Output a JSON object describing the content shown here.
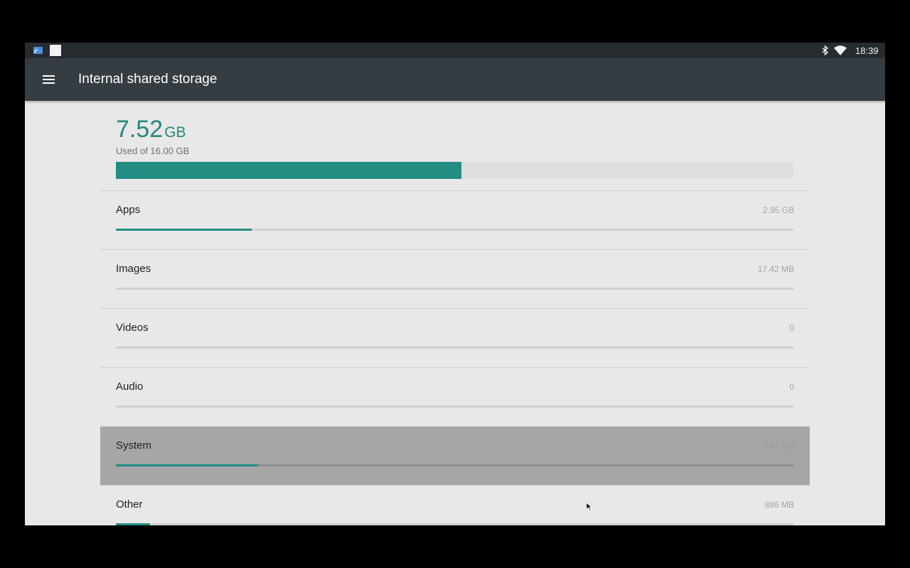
{
  "status_bar": {
    "time": "18:39",
    "left_icons": [
      "screen-cast-icon",
      "notification-square-icon"
    ],
    "right_icons": [
      "bluetooth-icon",
      "wifi-icon"
    ]
  },
  "toolbar": {
    "menu_icon": "hamburger-menu-icon",
    "title": "Internal shared storage"
  },
  "summary": {
    "used_value": "7.52",
    "used_unit": "GB",
    "caption": "Used of 16.00 GB",
    "used_fraction": 0.51
  },
  "categories": [
    {
      "label": "Apps",
      "size": "2.95 GB",
      "fraction": 0.2,
      "selected": false
    },
    {
      "label": "Images",
      "size": "17.42 MB",
      "fraction": 0.0,
      "selected": false
    },
    {
      "label": "Videos",
      "size": "0",
      "fraction": 0.0,
      "selected": false
    },
    {
      "label": "Audio",
      "size": "0",
      "fraction": 0.0,
      "selected": false
    },
    {
      "label": "System",
      "size": "3.17 GB",
      "fraction": 0.21,
      "selected": true
    },
    {
      "label": "Other",
      "size": "886 MB",
      "fraction": 0.05,
      "selected": false
    }
  ],
  "colors": {
    "accent": "#238c83",
    "toolbar": "#353c42",
    "status_bar": "#262b2f",
    "background": "#e8e8e8"
  }
}
